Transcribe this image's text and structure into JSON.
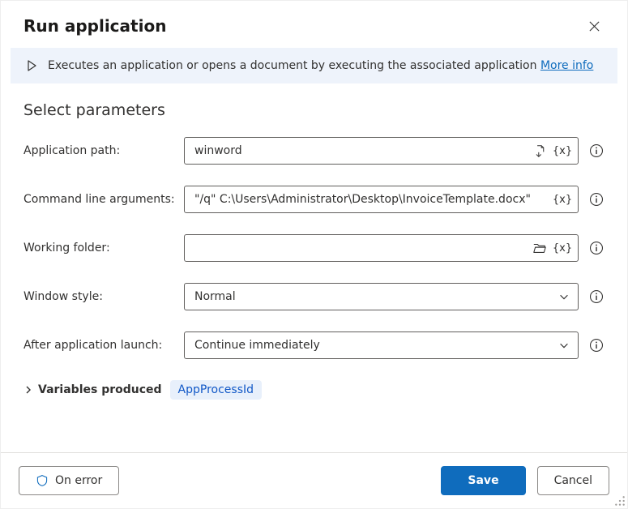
{
  "header": {
    "title": "Run application"
  },
  "banner": {
    "text": "Executes an application or opens a document by executing the associated application ",
    "moreInfo": "More info"
  },
  "section": {
    "title": "Select parameters"
  },
  "fields": {
    "appPath": {
      "label": "Application path:",
      "value": "winword"
    },
    "args": {
      "label": "Command line arguments:",
      "value": "\"/q\" C:\\Users\\Administrator\\Desktop\\InvoiceTemplate.docx\""
    },
    "workingFolder": {
      "label": "Working folder:",
      "value": ""
    },
    "windowStyle": {
      "label": "Window style:",
      "value": "Normal"
    },
    "afterLaunch": {
      "label": "After application launch:",
      "value": "Continue immediately"
    }
  },
  "variables": {
    "expanderLabel": "Variables produced",
    "items": [
      "AppProcessId"
    ]
  },
  "footer": {
    "onError": "On error",
    "save": "Save",
    "cancel": "Cancel"
  }
}
